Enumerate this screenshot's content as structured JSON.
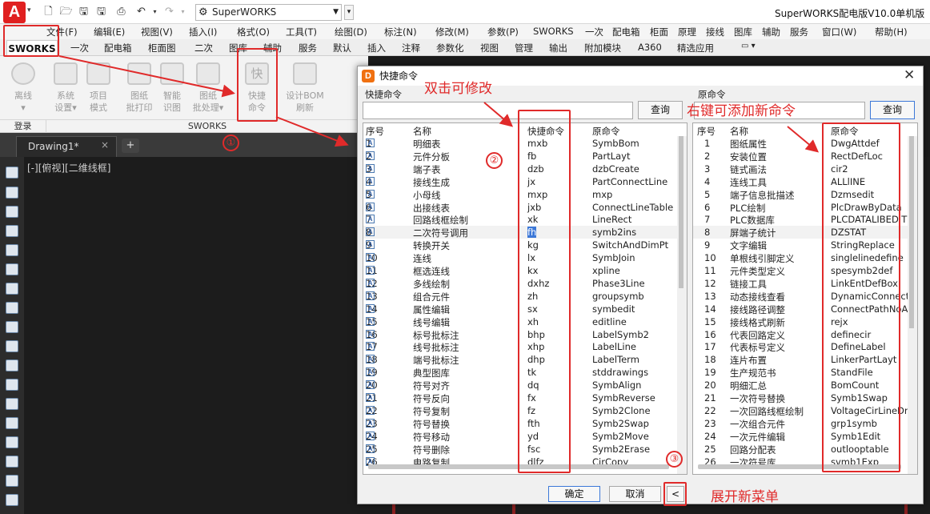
{
  "window": {
    "title": "SuperWORKS配电版V10.0单机版",
    "file": "SuperWORKS",
    "logo": "A"
  },
  "menubar": [
    "文件(F)",
    "编辑(E)",
    "视图(V)",
    "插入(I)",
    "格式(O)",
    "工具(T)",
    "绘图(D)",
    "标注(N)",
    "修改(M)",
    "参数(P)",
    "SWORKS",
    "一次",
    "配电箱",
    "柜面",
    "原理",
    "接线",
    "图库",
    "辅助",
    "服务",
    "窗口(W)",
    "帮助(H)"
  ],
  "ribbon_tabs": [
    "SWORKS",
    "一次",
    "配电箱",
    "柜面图",
    "二次",
    "图库",
    "辅助",
    "服务",
    "默认",
    "插入",
    "注释",
    "参数化",
    "视图",
    "管理",
    "输出",
    "附加模块",
    "A360",
    "精选应用"
  ],
  "ribbon": {
    "buttons": [
      {
        "label1": "离线",
        "label2": ""
      },
      {
        "label1": "系统",
        "label2": "设置"
      },
      {
        "label1": "项目",
        "label2": "模式"
      },
      {
        "label1": "图纸",
        "label2": "批打印"
      },
      {
        "label1": "智能",
        "label2": "识图"
      },
      {
        "label1": "图纸",
        "label2": "批处理"
      },
      {
        "label1": "快捷",
        "label2": "命令"
      },
      {
        "label1": "设计BOM",
        "label2": "刷新"
      }
    ],
    "panel_login": "登录",
    "panel_sworks": "SWORKS"
  },
  "doc_tab": {
    "name": "Drawing1*",
    "close": "×",
    "add": "+"
  },
  "view_label": "[-][俯视][二维线框]",
  "dialog": {
    "title": "快捷命令",
    "left_group": "快捷命令",
    "right_group": "原命令",
    "search_btn_left": "查询",
    "search_btn_right": "查询",
    "ok": "确定",
    "cancel": "取消",
    "expand": "<",
    "left_headers": [
      "序号",
      "名称",
      "快捷命令",
      "原命令"
    ],
    "right_headers": [
      "序号",
      "名称",
      "原命令"
    ],
    "left_rows": [
      [
        "1",
        "明细表",
        "mxb",
        "SymbBom"
      ],
      [
        "2",
        "元件分板",
        "fb",
        "PartLayt"
      ],
      [
        "3",
        "端子表",
        "dzb",
        "dzbCreate"
      ],
      [
        "4",
        "接线生成",
        "jx",
        "PartConnectLine"
      ],
      [
        "5",
        "小母线",
        "mxp",
        "mxp"
      ],
      [
        "6",
        "出接线表",
        "jxb",
        "ConnectLineTable"
      ],
      [
        "7",
        "回路线框绘制",
        "xk",
        "LineRect"
      ],
      [
        "8",
        "二次符号调用",
        "fh",
        "symb2ins"
      ],
      [
        "9",
        "转换开关",
        "kg",
        "SwitchAndDimPt"
      ],
      [
        "10",
        "连线",
        "lx",
        "SymbJoin"
      ],
      [
        "11",
        "框选连线",
        "kx",
        "xpline"
      ],
      [
        "12",
        "多线绘制",
        "dxhz",
        "Phase3Line"
      ],
      [
        "13",
        "组合元件",
        "zh",
        "groupsymb"
      ],
      [
        "14",
        "属性编辑",
        "sx",
        "symbedit"
      ],
      [
        "15",
        "线号编辑",
        "xh",
        "editline"
      ],
      [
        "16",
        "标号批标注",
        "bhp",
        "LabelSymb2"
      ],
      [
        "17",
        "线号批标注",
        "xhp",
        "LabelLine"
      ],
      [
        "18",
        "端号批标注",
        "dhp",
        "LabelTerm"
      ],
      [
        "19",
        "典型图库",
        "tk",
        "stddrawings"
      ],
      [
        "20",
        "符号对齐",
        "dq",
        "SymbAlign"
      ],
      [
        "21",
        "符号反向",
        "fx",
        "SymbReverse"
      ],
      [
        "22",
        "符号复制",
        "fz",
        "Symb2Clone"
      ],
      [
        "23",
        "符号替换",
        "fth",
        "Symb2Swap"
      ],
      [
        "24",
        "符号移动",
        "yd",
        "Symb2Move"
      ],
      [
        "25",
        "符号删除",
        "fsc",
        "Symb2Erase"
      ],
      [
        "26",
        "电路复制",
        "dlfz",
        "CirCopy"
      ]
    ],
    "right_rows": [
      [
        "1",
        "图纸属性",
        "DwgAttdef"
      ],
      [
        "2",
        "安装位置",
        "RectDefLoc"
      ],
      [
        "3",
        "链式画法",
        "cir2"
      ],
      [
        "4",
        "连线工具",
        "ALLlINE"
      ],
      [
        "5",
        "端子信息批描述",
        "Dzmsedit"
      ],
      [
        "6",
        "PLC绘制",
        "PlcDrawByData"
      ],
      [
        "7",
        "PLC数据库",
        "PLCDATALIBEDIT"
      ],
      [
        "8",
        "屏端子统计",
        "DZSTAT"
      ],
      [
        "9",
        "文字编辑",
        "StringReplace"
      ],
      [
        "10",
        "单根线引脚定义",
        "singlelinedefine"
      ],
      [
        "11",
        "元件类型定义",
        "spesymb2def"
      ],
      [
        "12",
        "链接工具",
        "LinkEntDefBox"
      ],
      [
        "13",
        "动态接线查看",
        "DynamicConnect..."
      ],
      [
        "14",
        "接线路径调整",
        "ConnectPathNoA..."
      ],
      [
        "15",
        "接线格式刷新",
        "rejx"
      ],
      [
        "16",
        "代表回路定义",
        "definecir"
      ],
      [
        "17",
        "代表标号定义",
        "DefineLabel"
      ],
      [
        "18",
        "连片布置",
        "LinkerPartLayt"
      ],
      [
        "19",
        "生产规范书",
        "StandFile"
      ],
      [
        "20",
        "明细汇总",
        "BomCount"
      ],
      [
        "21",
        "一次符号替换",
        "Symb1Swap"
      ],
      [
        "22",
        "一次回路线框绘制",
        "VoltageCirLineDr..."
      ],
      [
        "23",
        "一次组合元件",
        "grp1symb"
      ],
      [
        "24",
        "一次元件编辑",
        "Symb1Edit"
      ],
      [
        "25",
        "回路分配表",
        "outlooptable"
      ],
      [
        "26",
        "一次符号库",
        "svmb1Exp"
      ]
    ]
  },
  "annotations": {
    "dblclick": "双击可修改",
    "rightclick": "右键可添加新命令",
    "expand": "展开新菜单",
    "c1": "①",
    "c2": "②",
    "c3": "③"
  },
  "colors": {
    "annotation": "#e02a2a",
    "selection": "#3c78d8"
  }
}
